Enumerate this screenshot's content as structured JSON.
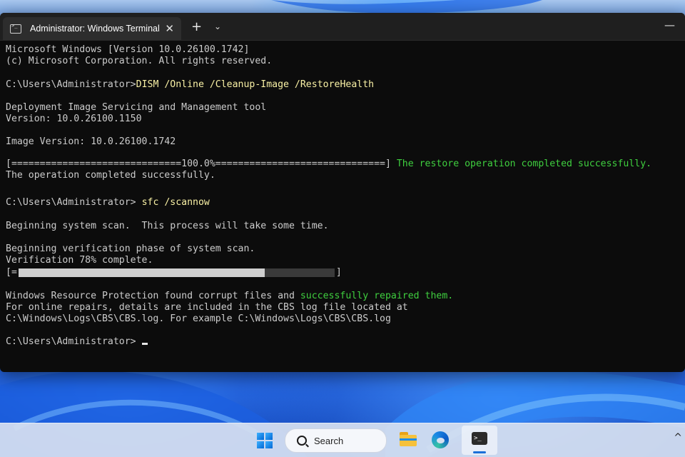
{
  "window": {
    "tab_title": "Administrator: Windows Terminal",
    "close_glyph": "✕",
    "new_tab_glyph": "+",
    "dropdown_glyph": "⌄",
    "minimize_glyph": "—"
  },
  "console": {
    "header_1": "Microsoft Windows [Version 10.0.26100.1742]",
    "header_2": "(c) Microsoft Corporation. All rights reserved.",
    "prompt_1": "C:\\Users\\Administrator>",
    "command_1": "DISM /Online /Cleanup-Image /RestoreHealth",
    "dism_line_1": "Deployment Image Servicing and Management tool",
    "dism_line_2": "Version: 10.0.26100.1150",
    "image_version": "Image Version: 10.0.26100.1742",
    "dism_progress_bar": "[==============================100.0%==============================]",
    "dism_progress_msg": "The restore operation completed successfully.",
    "dism_done": "The operation completed successfully.",
    "prompt_2": "C:\\Users\\Administrator>",
    "command_2": "sfc /scannow",
    "sfc_begin": "Beginning system scan.  This process will take some time.",
    "sfc_verify_1": "Beginning verification phase of system scan.",
    "sfc_verify_2": "Verification 78% complete.",
    "sfc_bar_open": "[=",
    "sfc_bar_close": "]",
    "sfc_progress": 0.78,
    "result_1a": "Windows Resource Protection found corrupt files and ",
    "result_1b": "successfully repaired them.",
    "result_2": "For online repairs, details are included in the CBS log file located at",
    "result_3": "C:\\Windows\\Logs\\CBS\\CBS.log. For example C:\\Windows\\Logs\\CBS\\CBS.log",
    "prompt_3": "C:\\Users\\Administrator>"
  },
  "taskbar": {
    "search_label": "Search",
    "terminal_icon_text": ">_",
    "tray_chevron": "^"
  },
  "colors": {
    "accent": "#1a6fd8",
    "command": "#f9f1a5",
    "success": "#3fcf3f",
    "console_bg": "#0c0c0c"
  }
}
